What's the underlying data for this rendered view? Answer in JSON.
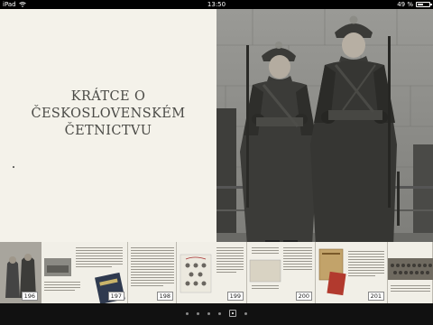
{
  "status_bar": {
    "device": "iPad",
    "time": "13:50",
    "battery_text": "49 %",
    "battery_level": 0.49
  },
  "page": {
    "title_lines": [
      "KRÁTCE O",
      "ČESKOSLOVENSKÉM",
      "ČETNICTVU"
    ]
  },
  "thumbnails": [
    {
      "number": "196"
    },
    {
      "number": "197"
    },
    {
      "number": "198"
    },
    {
      "number": "199"
    },
    {
      "number": "200"
    },
    {
      "number": "201"
    }
  ],
  "page_indicator": {
    "count": 6,
    "active": 5
  },
  "colors": {
    "page_background": "#f4f2ea",
    "title_text": "#4a4a46"
  }
}
